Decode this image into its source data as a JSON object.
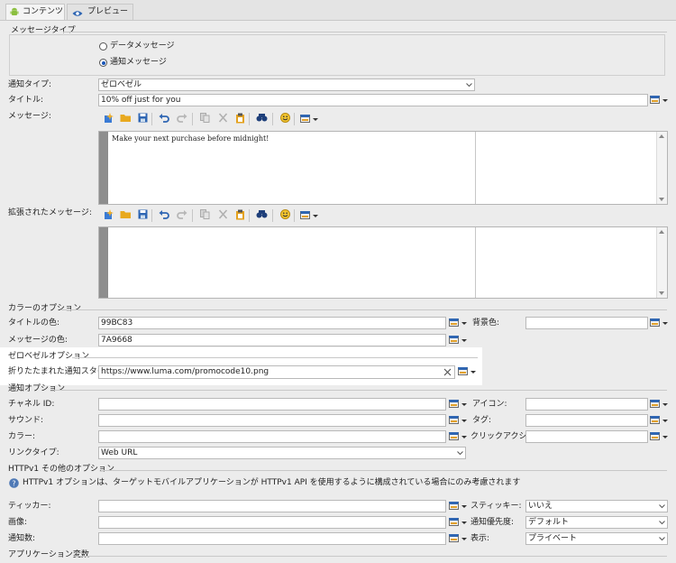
{
  "tabs": [
    {
      "label": "コンテンツ",
      "icon": "android-icon",
      "active": true
    },
    {
      "label": "プレビュー",
      "icon": "eye-icon",
      "active": false
    }
  ],
  "message_type": {
    "section": "メッセージタイプ",
    "options": [
      {
        "label": "データメッセージ",
        "selected": false
      },
      {
        "label": "通知メッセージ",
        "selected": true
      }
    ]
  },
  "form": {
    "notification_type": {
      "label": "通知タイプ:",
      "value": "ゼロベゼル"
    },
    "title": {
      "label": "タイトル:",
      "value": "10% off just for you"
    },
    "message": {
      "label": "メッセージ:",
      "body": "Make your next purchase before midnight!"
    },
    "extended_message": {
      "label": "拡張されたメッセージ:",
      "body": ""
    }
  },
  "color_options": {
    "section": "カラーのオプション",
    "title_color": {
      "label": "タイトルの色:",
      "value": "99BC83"
    },
    "message_color": {
      "label": "メッセージの色:",
      "value": "7A9668"
    },
    "background_color": {
      "label": "背景色:",
      "value": ""
    }
  },
  "zero_bezel": {
    "section": "ゼロベゼルオプション",
    "collapsed_style": {
      "label": "折りたたまれた通知スタイル:",
      "value": "https://www.luma.com/promocode10.png"
    }
  },
  "notification_options": {
    "section": "通知オプション",
    "channel_id": {
      "label": "チャネル ID:",
      "value": ""
    },
    "sound": {
      "label": "サウンド:",
      "value": ""
    },
    "color": {
      "label": "カラー:",
      "value": ""
    },
    "link_type": {
      "label": "リンクタイプ:",
      "value": "Web URL"
    },
    "icon": {
      "label": "アイコン:",
      "value": ""
    },
    "tag": {
      "label": "タグ:",
      "value": ""
    },
    "click_action": {
      "label": "クリックアクション:",
      "value": ""
    }
  },
  "httpv1": {
    "section": "HTTPv1 その他のオプション",
    "info": "HTTPv1 オプションは、ターゲットモバイルアプリケーションが HTTPv1 API を使用するように構成されている場合にのみ考慮されます",
    "ticker": {
      "label": "ティッカー:",
      "value": ""
    },
    "image": {
      "label": "画像:",
      "value": ""
    },
    "notification_count": {
      "label": "通知数:",
      "value": ""
    },
    "sticky": {
      "label": "スティッキー:",
      "value": "いいえ"
    },
    "priority": {
      "label": "通知優先度:",
      "value": "デフォルト"
    },
    "visibility": {
      "label": "表示:",
      "value": "プライベート"
    }
  },
  "app_variables": {
    "section": "アプリケーション変数"
  },
  "toolbar_icons": [
    "insert-icon",
    "open-folder-icon",
    "save-icon",
    "undo-icon",
    "redo-icon",
    "copy-icon",
    "cut-icon",
    "paste-icon",
    "find-icon",
    "emoji-icon",
    "personalization-icon"
  ],
  "colors": {
    "highlight": "#ffffff",
    "accent": "#1a56b8",
    "background": "#ececec"
  }
}
